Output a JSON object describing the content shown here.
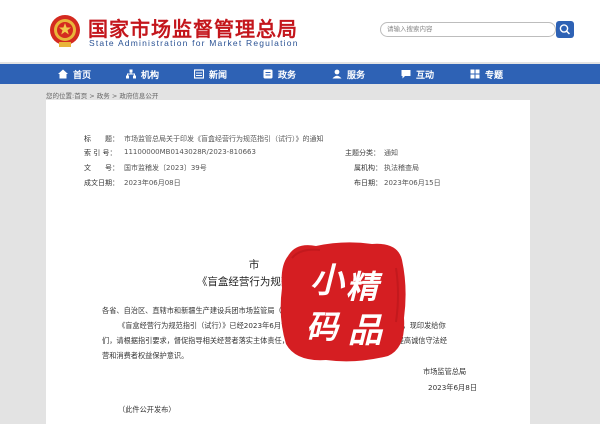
{
  "header": {
    "title": "国家市场监督管理总局",
    "subtitle": "State Administration for Market Regulation",
    "search_placeholder": "请输入搜索内容"
  },
  "nav": {
    "items": [
      {
        "label": "首页",
        "icon": "home-icon"
      },
      {
        "label": "机构",
        "icon": "org-icon"
      },
      {
        "label": "新闻",
        "icon": "news-icon"
      },
      {
        "label": "政务",
        "icon": "gov-icon"
      },
      {
        "label": "服务",
        "icon": "service-icon"
      },
      {
        "label": "互动",
        "icon": "interact-icon"
      },
      {
        "label": "专题",
        "icon": "topic-icon"
      }
    ]
  },
  "breadcrumb": "您的位置:首页 > 政务 > 政府信息公开",
  "meta": {
    "title_label": "标　　题：",
    "title_value": "市场监管总局关于印发《盲盒经营行为规范指引（试行）》的通知",
    "index_label": "索  引  号：",
    "index_value": "11100000MB0143028R/2023-810663",
    "topic_label": "主题分类：",
    "topic_value": "通知",
    "docno_label": "文　　号：",
    "docno_value": "国市监稽发〔2023〕39号",
    "dept_label": "属机构：",
    "dept_value": "执法稽查局",
    "date_label": "成文日期：",
    "date_value": "2023年06月08日",
    "pub_label": "布日期：",
    "pub_value": "2023年06月15日"
  },
  "doc": {
    "title_line1": "市",
    "title_line2": "《盲盒经营行为规范指引（试行）》的通知",
    "addressee": "各省、自治区、直辖市和新疆生产建设兵团市场监管局（厅、委）：",
    "body_line1": "《盲盒经营行为规范指引（试行）》已经2023年6月7日市场监管总局第10次局务会议通过，现印发给你",
    "body_line2": "们，请根据指引要求，督促指导相关经营者落实主体责任，强化盲盒经营活动合规管理，切实提高诚信守法经",
    "body_line3": "营和消费者权益保护意识。",
    "signer": "市场监管总局",
    "sign_date": "2023年6月8日",
    "footer_note": "（此件公开发布）"
  },
  "stamp": {
    "text": "小精码品",
    "color": "#d51e22"
  },
  "colors": {
    "brand_red": "#c4161c",
    "nav_blue": "#2e62b5"
  }
}
